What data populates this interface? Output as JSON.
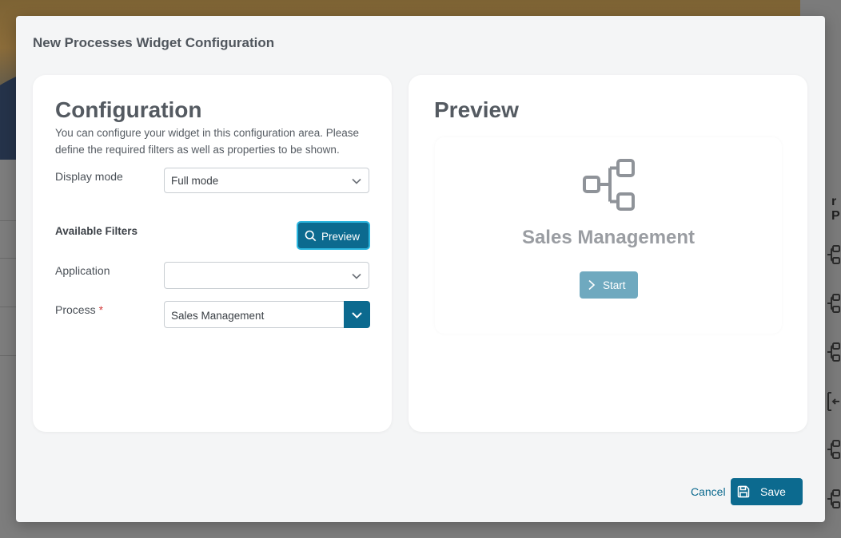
{
  "modal": {
    "title": "New Processes Widget Configuration"
  },
  "configuration": {
    "heading": "Configuration",
    "description": "You can configure your widget in this configuration area. Please define the required filters as well as properties to be shown.",
    "display_mode": {
      "label": "Display mode",
      "value": "Full mode"
    },
    "filters": {
      "heading": "Available Filters",
      "preview_button_label": "Preview",
      "application": {
        "label": "Application",
        "value": ""
      },
      "process": {
        "label": "Process",
        "required_marker": "*",
        "value": "Sales Management"
      }
    }
  },
  "preview": {
    "heading": "Preview",
    "widget": {
      "icon": "process-diagram-icon",
      "title": "Sales Management",
      "start_button_label": "Start"
    }
  },
  "footer": {
    "cancel_label": "Cancel",
    "save_label": "Save"
  },
  "background": {
    "side_header": "r P"
  },
  "colors": {
    "primary": "#0c6a8f",
    "focus_ring": "#2bb6df",
    "start_button": "#6fa9bf",
    "required": "#d33a3a"
  }
}
